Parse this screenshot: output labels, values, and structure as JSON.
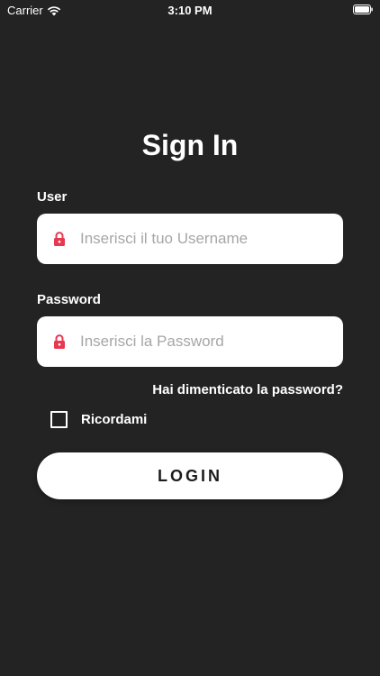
{
  "status_bar": {
    "carrier": "Carrier",
    "time": "3:10 PM",
    "icons": [
      "wifi-icon",
      "battery-icon"
    ]
  },
  "title": "Sign In",
  "user_field": {
    "label": "User",
    "placeholder": "Inserisci il tuo Username",
    "value": "",
    "icon": "lock-icon"
  },
  "password_field": {
    "label": "Password",
    "placeholder": "Inserisci la Password",
    "value": "",
    "icon": "lock-icon"
  },
  "forgot_password": "Hai dimenticato la password?",
  "remember_me": {
    "label": "Ricordami",
    "checked": false
  },
  "login_button": "LOGIN",
  "colors": {
    "background": "#232323",
    "accent_lock": "#e8384f",
    "text": "#ffffff",
    "input_bg": "#ffffff"
  }
}
